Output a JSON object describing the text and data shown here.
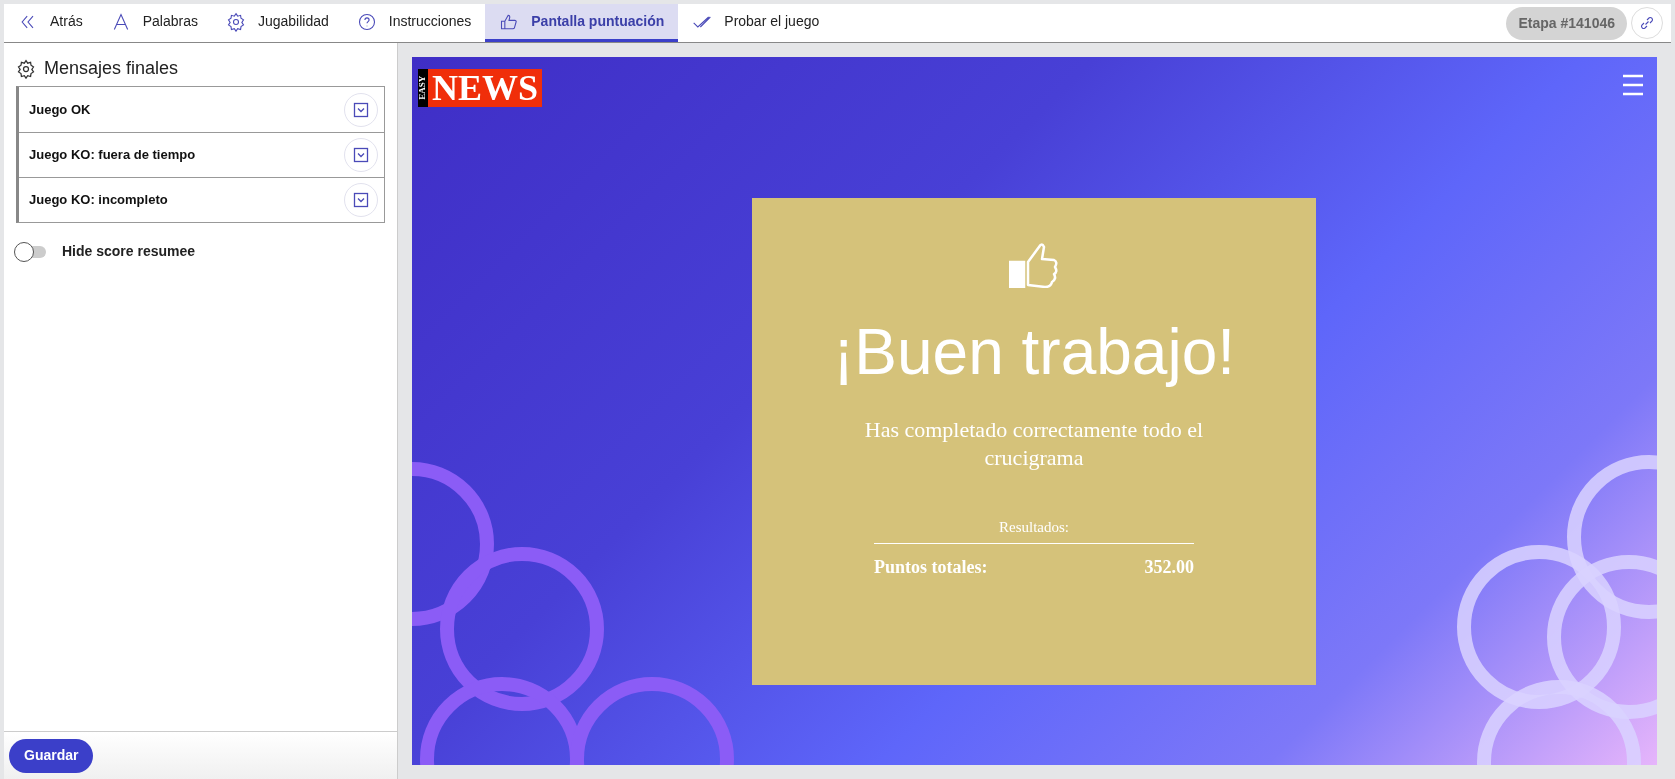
{
  "tabs": [
    {
      "label": "Atrás",
      "selected": false
    },
    {
      "label": "Palabras",
      "selected": false
    },
    {
      "label": "Jugabilidad",
      "selected": false
    },
    {
      "label": "Instrucciones",
      "selected": false
    },
    {
      "label": "Pantalla puntuación",
      "selected": true
    },
    {
      "label": "Probar el juego",
      "selected": false
    }
  ],
  "stage_badge": "Etapa #141046",
  "sidebar": {
    "title": "Mensajes finales",
    "messages": [
      {
        "label": "Juego OK",
        "expanded": false
      },
      {
        "label": "Juego KO: fuera de tiempo",
        "expanded": false
      },
      {
        "label": "Juego KO: incompleto",
        "expanded": false
      }
    ],
    "toggle": {
      "label": "Hide score resumee",
      "on": false
    },
    "save_button": "Guardar"
  },
  "preview": {
    "logo": {
      "small": "EASY",
      "large": "NEWS"
    },
    "heading": "¡Buen trabajo!",
    "message": "Has completado correctamente todo el crucigrama",
    "results_label": "Resultados:",
    "score_label": "Puntos totales:",
    "score_value": "352.00"
  }
}
